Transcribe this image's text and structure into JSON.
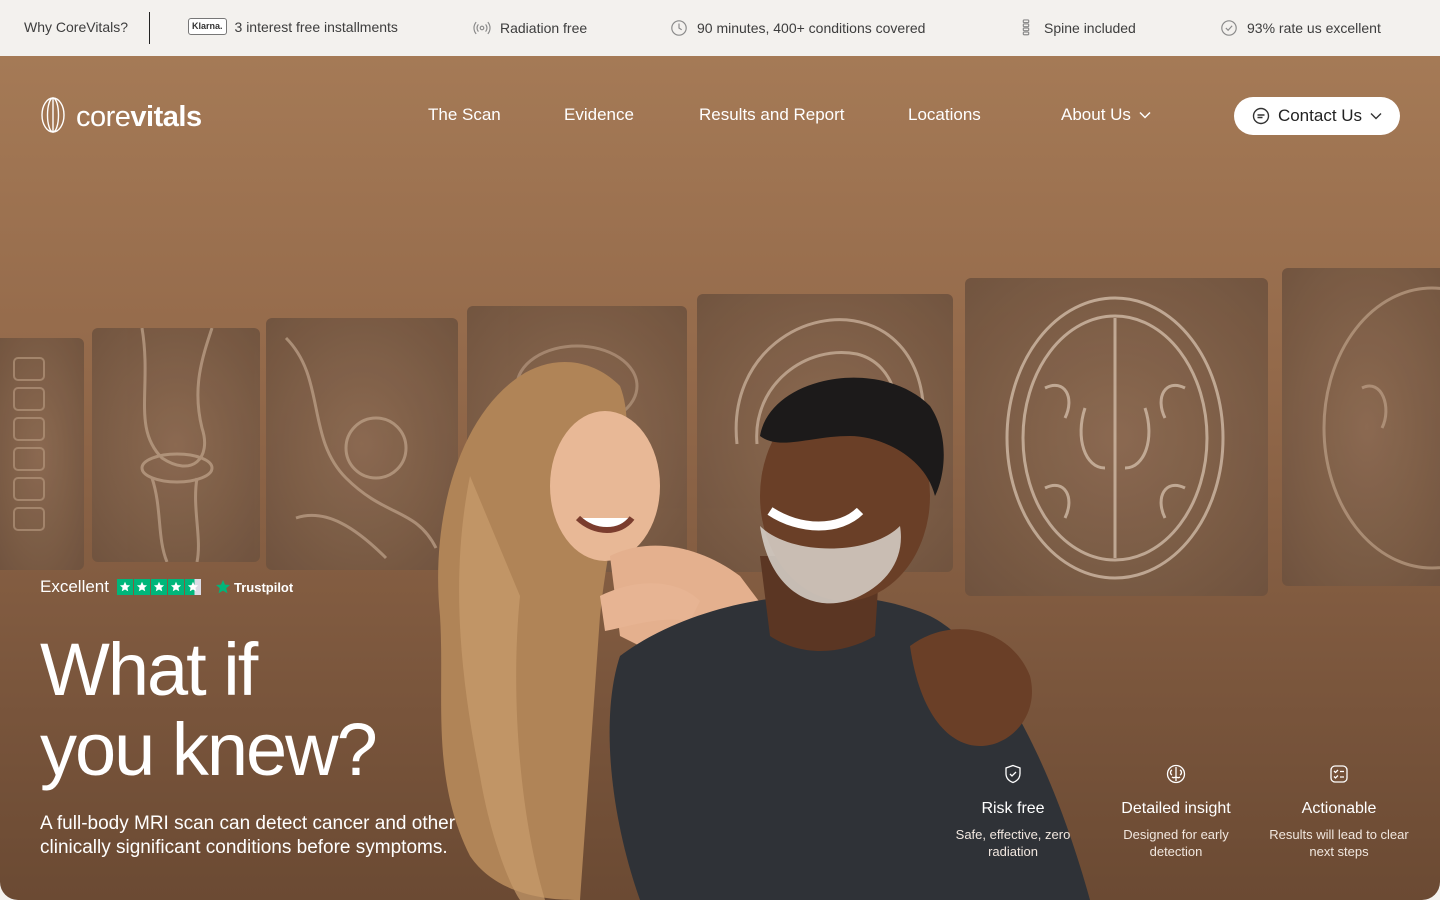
{
  "topbar": {
    "why_label": "Why CoreVitals?",
    "klarna_badge": "Klarna.",
    "items": [
      {
        "label": "3 interest free installments"
      },
      {
        "label": "Radiation free",
        "icon": "radiation-free-icon"
      },
      {
        "label": "90 minutes, 400+ conditions covered",
        "icon": "clock-icon"
      },
      {
        "label": "Spine included",
        "icon": "spine-icon"
      },
      {
        "label": "93% rate us excellent",
        "icon": "check-circle-icon"
      }
    ]
  },
  "brand": {
    "name_light": "core",
    "name_bold": "vitals"
  },
  "nav": {
    "items": [
      {
        "label": "The Scan"
      },
      {
        "label": "Evidence"
      },
      {
        "label": "Results and Report"
      },
      {
        "label": "Locations"
      },
      {
        "label": "About Us",
        "has_dropdown": true
      }
    ],
    "contact_label": "Contact Us"
  },
  "trust": {
    "rating_word": "Excellent",
    "stars": 4.5,
    "provider": "Trustpilot"
  },
  "hero": {
    "headline_line1": "What if",
    "headline_line2": "you knew?",
    "subline": "A full-body MRI scan can detect cancer and other clinically significant conditions before symptoms."
  },
  "features": [
    {
      "icon": "shield-check-icon",
      "title": "Risk free",
      "desc": "Safe, effective, zero radiation"
    },
    {
      "icon": "brain-icon",
      "title": "Detailed insight",
      "desc": "Designed for early detection"
    },
    {
      "icon": "checklist-icon",
      "title": "Actionable",
      "desc": "Results will lead to clear next steps"
    }
  ],
  "colors": {
    "hero_top": "#a57a56",
    "hero_bottom": "#6b4a33",
    "trustpilot_green": "#00b67a",
    "topbar_bg": "#f3f1ee"
  }
}
